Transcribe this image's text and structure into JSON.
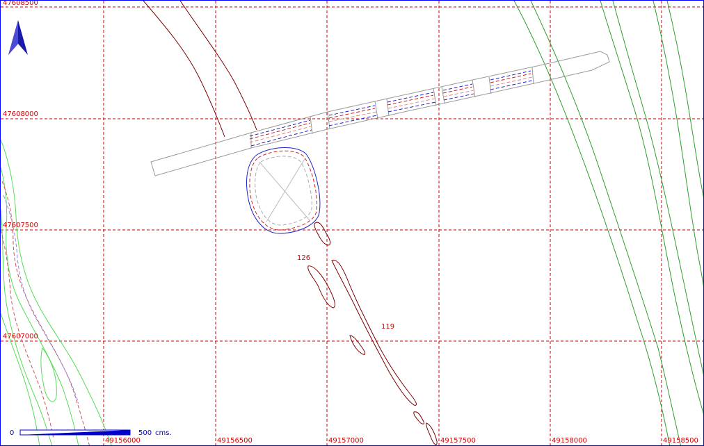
{
  "map": {
    "grid_color": "#cc0000",
    "contour_color": "#7a0000",
    "label_color": "#cc0000",
    "river_color": "#2e9e2e",
    "river_light_color": "#55dd55",
    "outline_color": "#999999",
    "pond_color": "#2222cc",
    "y_labels": [
      "47608500",
      "47608000",
      "47607500",
      "47607000"
    ],
    "x_labels": [
      "49156000",
      "49156500",
      "49157000",
      "49157500",
      "49158000",
      "49158500"
    ],
    "contour_labels": [
      "126",
      "119"
    ]
  },
  "north_arrow": {
    "icon": "north-arrow-icon",
    "color": "#1a1aa8"
  },
  "scale_bar": {
    "start_label": "0",
    "end_label": "500",
    "unit": "cms.",
    "color": "#0000cc"
  }
}
